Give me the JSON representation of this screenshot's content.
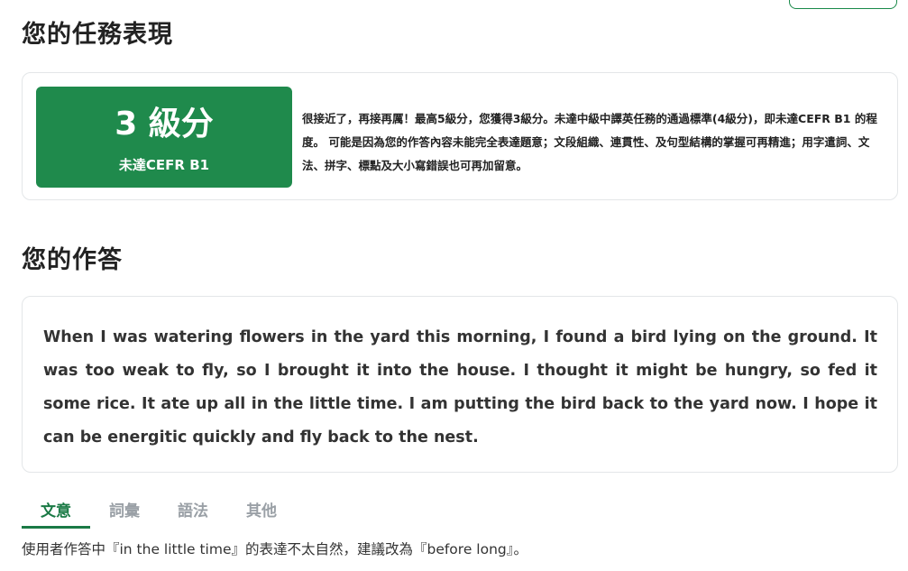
{
  "performance": {
    "title": "您的任務表現",
    "level": "3 級分",
    "cefr_status": "未達CEFR B1",
    "comment": "很接近了，再接再厲！最高5級分，您獲得3級分。未達中級中譯英任務的通過標準(4級分)，即未達CEFR B1 的程度。 可能是因為您的作答內容未能完全表達題意；文段組織、連貫性、及句型結構的掌握可再精進；用字遣詞、文法、拼字、標點及大小寫錯誤也可再加留意。"
  },
  "answer": {
    "title": "您的作答",
    "text": "When I was watering flowers in the yard this morning, I found a bird lying on the ground. It was too weak to fly, so I brought it into the house. I thought it might be hungry, so fed it some rice. It ate up all in the little time. I am putting the bird back to the yard now. I hope it can be energitic quickly and fly back to the nest."
  },
  "tabs": [
    {
      "label": "文意",
      "active": true
    },
    {
      "label": "詞彙",
      "active": false
    },
    {
      "label": "語法",
      "active": false
    },
    {
      "label": "其他",
      "active": false
    }
  ],
  "feedback": {
    "text": "使用者作答中『in the little time』的表達不太自然，建議改為『before long』。"
  },
  "colors": {
    "accent": "#1f8a4c",
    "tab_active": "#1a7a45",
    "tab_inactive": "#9aa0a6",
    "card_border": "#e3e6e8"
  }
}
